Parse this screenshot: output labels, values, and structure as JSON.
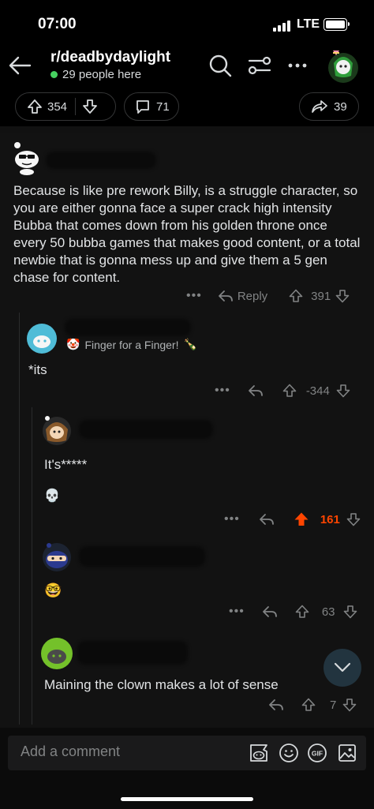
{
  "status_bar": {
    "time": "07:00",
    "network": "LTE"
  },
  "header": {
    "subreddit": "r/deadbydaylight",
    "online_count": "29 people here"
  },
  "post_stats": {
    "upvotes": "354",
    "comments": "71",
    "shares": "39"
  },
  "comments": [
    {
      "text": "Because is like pre rework Billy, is a struggle character, so you are either gonna face a super crack high intensity Bubba that comes down from his golden throne once every 50 bubba games that makes good content, or a total newbie that is gonna mess up and give them a 5 gen chase for content.",
      "reply_label": "Reply",
      "score": "391"
    },
    {
      "flair": "Finger for a Finger!",
      "text": "*its",
      "score": "-344"
    },
    {
      "text": "It's*****",
      "emoji": "💀",
      "score": "161",
      "upvoted": true
    },
    {
      "emoji": "🤓",
      "score": "63"
    },
    {
      "text": "Maining the clown makes a lot of sense",
      "score": "7"
    }
  ],
  "composer": {
    "placeholder": "Add a comment"
  },
  "colors": {
    "background": "#121212",
    "upvote_active": "#ff4500",
    "online_dot": "#46d160",
    "muted": "#818384"
  }
}
